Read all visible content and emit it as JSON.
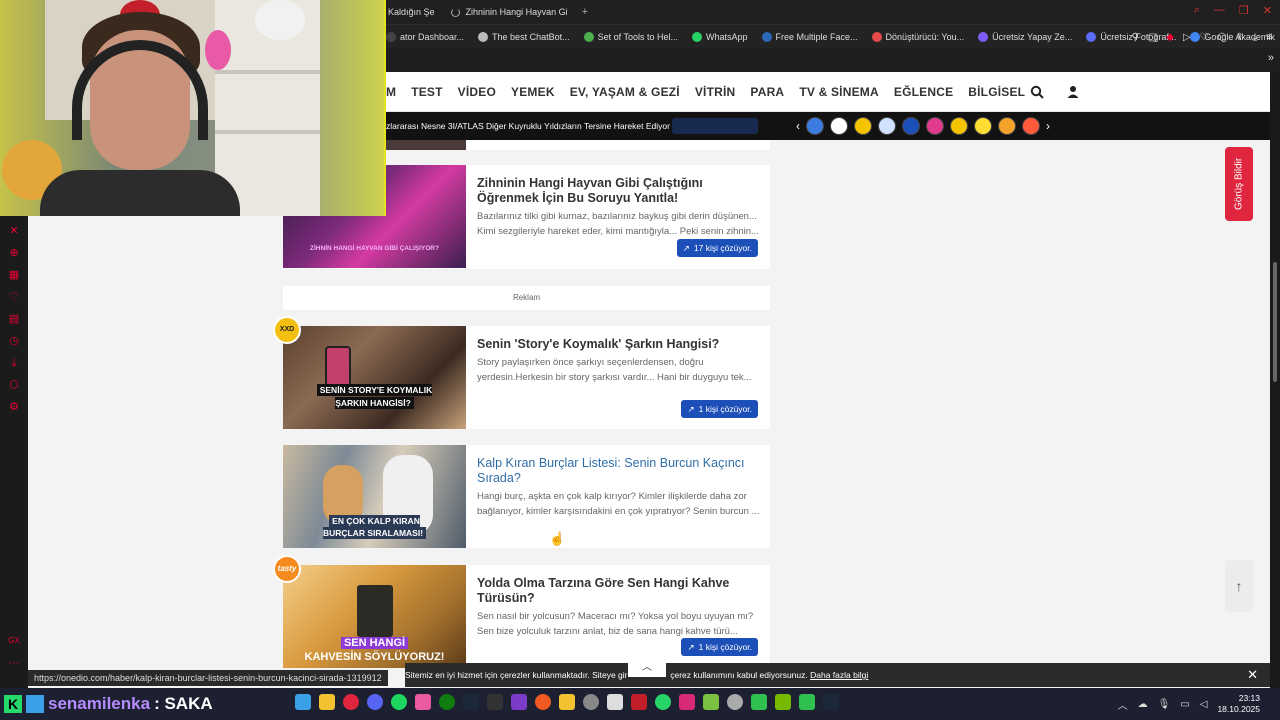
{
  "tabs": {
    "tab1": "Kaldığın Şe",
    "tab2": "Zihninin Hangi Hayvan Gi",
    "new_tab": "+"
  },
  "bookmarks": [
    {
      "label": "ator Dashboar...",
      "color": "#444"
    },
    {
      "label": "The best ChatBot...",
      "color": "#bbb"
    },
    {
      "label": "Set of Tools to Hel...",
      "color": "#4caf50"
    },
    {
      "label": "WhatsApp",
      "color": "#25d366"
    },
    {
      "label": "Free Multiple Face...",
      "color": "#2a6ab8"
    },
    {
      "label": "Dönüştürücü: You...",
      "color": "#e54b4b"
    },
    {
      "label": "Ücretsiz Yapay Ze...",
      "color": "#7d5cf5"
    },
    {
      "label": "Ücretsiz Fotoğraf...",
      "color": "#5a6cf5"
    },
    {
      "label": "Google Akademik",
      "color": "#4285f4"
    }
  ],
  "nav": {
    "items": [
      "M",
      "TEST",
      "VİDEO",
      "YEMEK",
      "EV, YAŞAM & GEZİ",
      "VİTRİN",
      "PARA",
      "TV & SİNEMA",
      "EĞLENCE",
      "BİLGİSEL"
    ],
    "search_icon": "search-icon",
    "user_icon": "user-icon"
  },
  "ticker": {
    "text": "zlararası Nesne 3I/ATLAS Diğer Kuyruklu Yıldızların Tersine Hareket Ediyor",
    "prev": "‹",
    "next": "›"
  },
  "feedback": "Görüş Bildir",
  "cards": [
    {
      "title": "Zihninin Hangi Hayvan Gibi Çalıştığını Öğrenmek İçin Bu Soruyu Yanıtla!",
      "desc": "Bazılarınız tilki gibi kurnaz, bazılarınız baykuş gibi derin düşünen... Kimi sezgileriyle hareket eder, kimi mantığıyla... Peki senin zihnin...",
      "solvers": "17 kişi çözüyor.",
      "image_caption": "ZİHNİN HANGİ HAYVAN GİBİ ÇALIŞIYOR?"
    },
    {
      "title": "Senin 'Story'e Koymalık' Şarkın Hangisi?",
      "desc": "Story paylaşırken önce şarkıyı seçenlerdensen, doğru yerdesin.Herkesin bir story şarkısı vardır... Hani bir duyguyu tek...",
      "solvers": "1 kişi çözüyor.",
      "image_caption": "SENİN STORY'E KOYMALIK ŞARKIN HANGİSİ?",
      "badge": "XXD"
    },
    {
      "title": "Kalp Kıran Burçlar Listesi: Senin Burcun Kaçıncı Sırada?",
      "desc": "Hangi burç, aşkta en çok kalp kırıyor? Kimler ilişkilerde daha zor bağlanıyor, kimler karşısındakini en çok yıpratıyor? Senin burcun ...",
      "image_caption": "EN ÇOK KALP KIRAN BURÇLAR SIRALAMASI!"
    },
    {
      "title": "Yolda Olma Tarzına Göre Sen Hangi Kahve Türüsün?",
      "desc": "Sen nasıl bir yolcusun? Maceracı mı? Yoksa yol boyu uyuyan mı? Sen bize yolculuk tarzını anlat, biz de sana hangi kahve türü...",
      "solvers": "1 kişi çözüyor.",
      "image_caption_1": "SEN HANGİ",
      "image_caption_2": "KAHVESİN SÖYLÜYORUZ!",
      "badge": "tasty"
    }
  ],
  "ad_label": "Reklam",
  "cookie": {
    "text": "Sitemiz en iyi hizmet için çerezler kullanmaktadır. Siteye gir",
    "text2": "çerez kullanımını kabul ediyorsunuz.",
    "link": "Daha fazla bilgi",
    "close": "✕"
  },
  "status_url": "https://onedio.com/haber/kalp-kiran-burclar-listesi-senin-burcun-kacinci-sirada-1319912",
  "chat": {
    "user": "senamilenka",
    "message": ": SAKA"
  },
  "clock": {
    "time": "23:13",
    "date": "18.10.2025"
  },
  "colors": {
    "accent_blue": "#1d4fb8",
    "feedback_red": "#e0263f",
    "link_blue": "#2f6ea8"
  }
}
